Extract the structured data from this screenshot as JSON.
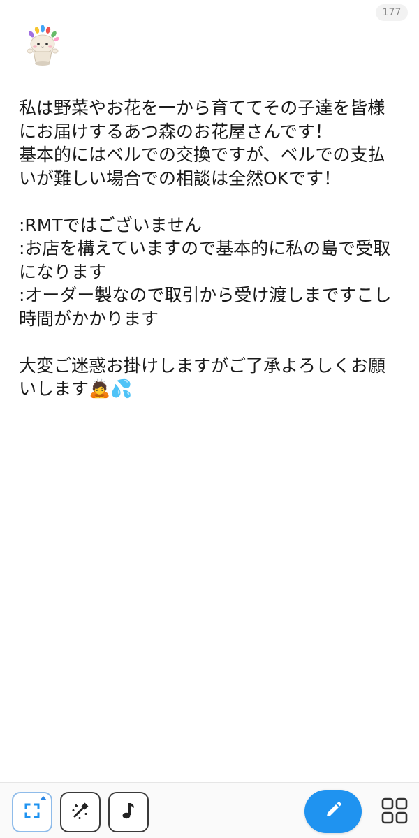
{
  "header": {
    "char_count": "177",
    "mascot_icon": "flower-hat-mascot-icon"
  },
  "post": {
    "text": "私は野菜やお花を一から育ててその子達を皆様にお届けするあつ森のお花屋さんです！\n基本的にはベルでの交換ですが、ベルでの支払いが難しい場合での相談は全然OKです！\n\n:RMTではございません\n:お店を構えていますので基本的に私の島で受取になります\n:オーダー製なので取引から受け渡しまですこし時間がかかります\n\n大変ご迷惑お掛けしますがご了承よろしくお願いします🙇💦"
  },
  "toolbar": {
    "tools": [
      {
        "icon": "expand-corners-icon",
        "active": true
      },
      {
        "icon": "magic-wand-icon",
        "active": false
      },
      {
        "icon": "music-note-icon",
        "active": false
      }
    ],
    "compose_icon": "pencil-icon",
    "menu_icon": "grid-menu-icon"
  },
  "colors": {
    "accent": "#1f93f0",
    "active_indicator": "#2b87e6",
    "text": "#1a1a1a",
    "muted": "#8a8a8a"
  }
}
